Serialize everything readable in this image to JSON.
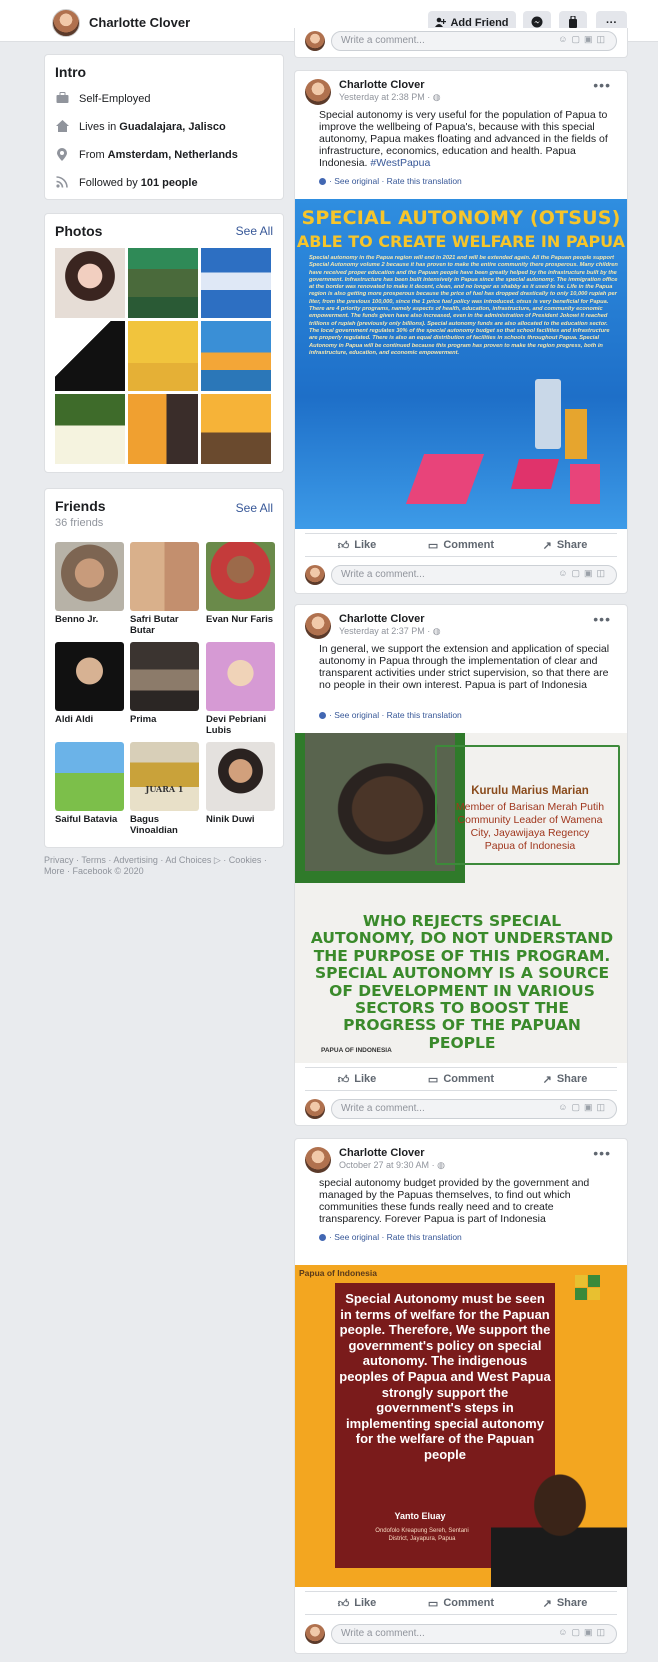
{
  "header": {
    "name": "Charlotte Clover",
    "add_friend": "Add Friend",
    "messenger_icon": "messenger-icon",
    "more_label": "···"
  },
  "intro": {
    "title": "Intro",
    "rows": [
      {
        "icon": "briefcase-icon",
        "prefix": "Self-Employed",
        "bold": ""
      },
      {
        "icon": "home-icon",
        "prefix": "Lives in",
        "bold": "Guadalajara, Jalisco"
      },
      {
        "icon": "location-pin-icon",
        "prefix": "From",
        "bold": "Amsterdam, Netherlands"
      },
      {
        "icon": "rss-icon",
        "prefix": "Followed by",
        "bold": "101 people"
      }
    ]
  },
  "photos": {
    "title": "Photos",
    "see_all": "See All"
  },
  "friends": {
    "title": "Friends",
    "count": "36 friends",
    "see_all": "See All",
    "list": [
      {
        "name": "Benno Jr."
      },
      {
        "name": "Safri Butar Butar"
      },
      {
        "name": "Evan Nur Faris"
      },
      {
        "name": "Aldi Aldi"
      },
      {
        "name": "Prima"
      },
      {
        "name": "Devi Pebriani Lubis"
      },
      {
        "name": "Saiful Batavia"
      },
      {
        "name": "Bagus Vinoaldian"
      },
      {
        "name": "Ninik Duwi"
      }
    ],
    "juara_text": "JUARA 1"
  },
  "footer": {
    "text": "Privacy · Terms · Advertising · Ad Choices ▷ · Cookies · More · Facebook © 2020"
  },
  "comment_placeholder": "Write a comment...",
  "actions": {
    "like": "Like",
    "comment": "Comment",
    "share": "Share"
  },
  "translation": {
    "see_original": "See original",
    "rate": "Rate this translation"
  },
  "posts": [
    {
      "author": "Charlotte Clover",
      "date": "Yesterday at 2:38 PM",
      "text": "Special autonomy is very useful for the population of Papua to improve the wellbeing of Papua's, because with this special autonomy, Papua makes floating and advanced in the fields of infrastructure, economics, education and health. Papua Indonesia.",
      "hashtag": "#WestPapua",
      "image": {
        "title_line1": "SPECIAL AUTONOMY (OTSUS)",
        "title_line2": "ABLE TO CREATE WELFARE IN PAPUA",
        "body": "Special autonomy in the Papua region will end in 2021 and will be extended again. All the Papuan people support Special Autonomy volume 2 because it has proven to make the entire community there prosperous. Many children have received proper education and the Papuan people have been greatly helped by the infrastructure built by the government. Infrastructure has been built intensively in Papua since the special autonomy. The immigration office at the border was renovated to make it decent, clean, and no longer as shabby as it used to be. Life in the Papua region is also getting more prosperous because the price of fuel has dropped drastically to only 10,000 rupiah per liter, from the previous 100,000, since the 1 price fuel policy was introduced. otsus is very beneficial for Papua. There are 4 priority programs, namely aspects of health, education, infrastructure, and community economic empowerment. The funds given have also increased, even in the administration of President Jokowi it reached trillions of rupiah (previously only billions). Special autonomy funds are also allocated to the education sector. The local government regulates 30% of the special autonomy budget so that school facilities and infrastructure are properly regulated. There is also an equal distribution of facilities in schools throughout Papua. Special Autonomy in Papua will be continued because this program has proven to make the region progress, both in infrastructure, education, and economic empowerment."
      }
    },
    {
      "author": "Charlotte Clover",
      "date": "Yesterday at 2:37 PM",
      "text": "In general, we support the extension and application of special autonomy in Papua through the implementation of clear and transparent activities under strict supervision, so that there are no people in their own interest. Papua is part of Indonesia",
      "image": {
        "person_name": "Kurulu Marius Marian",
        "person_role": "Member of Barisan Merah Putih Community Leader of Wamena City, Jayawijaya Regency Papua of Indonesia",
        "quote": "WHO REJECTS SPECIAL AUTONOMY, DO NOT UNDERSTAND THE PURPOSE OF THIS PROGRAM. SPECIAL AUTONOMY IS A SOURCE OF DEVELOPMENT IN VARIOUS SECTORS TO BOOST THE PROGRESS OF THE PAPUAN PEOPLE",
        "brand": "PAPUA OF INDONESIA"
      }
    },
    {
      "author": "Charlotte Clover",
      "date": "October 27 at 9:30 AM",
      "text": "special autonomy budget provided by the government and managed by the Papuas themselves, to find out which communities these funds really need and to create transparency. Forever Papua is part of Indonesia",
      "image": {
        "brand": "Papua of Indonesia",
        "quote": "Special Autonomy must be seen in terms of welfare for the Papuan people. Therefore, We support the government's policy on special autonomy. The indigenous peoples of Papua and West Papua strongly support the government's steps in implementing special autonomy for the welfare of the Papuan people",
        "person_name": "Yanto Eluay",
        "person_role": "Ondofolo Kreapung Sereh, Sentani District, Jayapura, Papua"
      }
    }
  ]
}
